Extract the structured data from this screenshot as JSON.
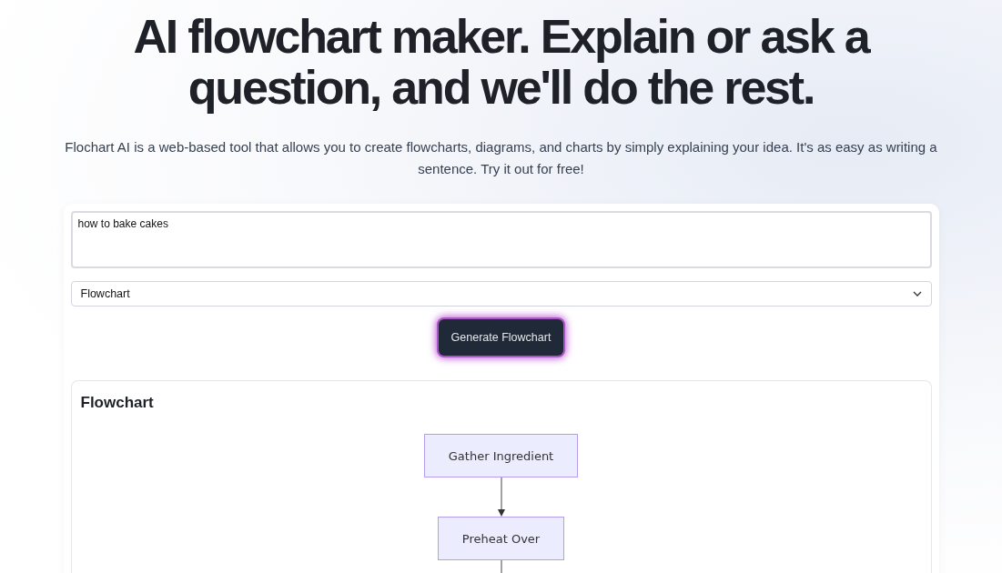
{
  "hero": {
    "title": "AI flowchart maker. Explain or ask a question, and we'll do the rest.",
    "subtitle": "Flochart AI is a web-based tool that allows you to create flowcharts, diagrams, and charts by simply explaining your idea. It's as easy as writing a sentence. Try it out for free!"
  },
  "form": {
    "prompt_value": "how to bake cakes",
    "chart_type": "Flowchart",
    "button": "Generate Flowchart"
  },
  "result": {
    "title": "Flowchart",
    "nodes": [
      {
        "label": "Gather Ingredient"
      },
      {
        "label": "Preheat Over"
      }
    ]
  }
}
